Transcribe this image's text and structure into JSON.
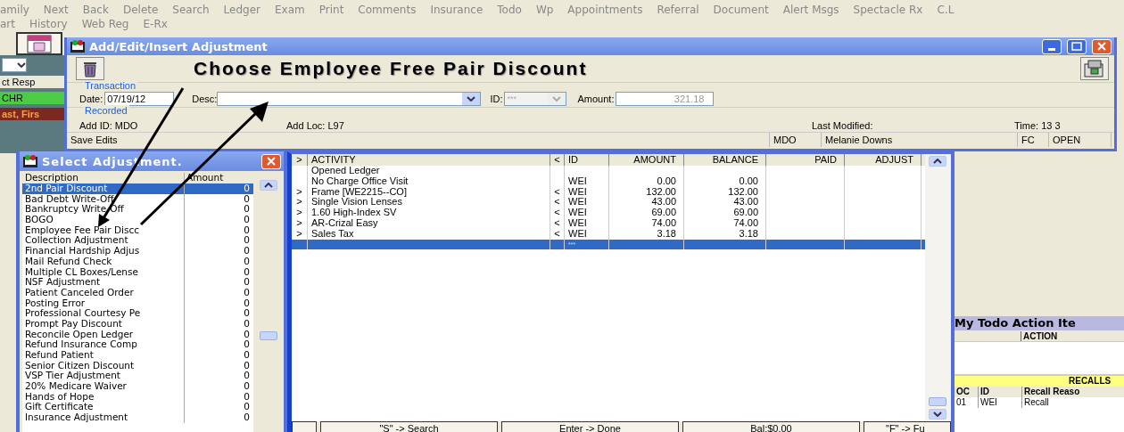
{
  "menu_bar": {
    "row_1": [
      "amily",
      "Next",
      "Back",
      "Delete",
      "Search",
      "Ledger",
      "Exam",
      "Print",
      "Comments",
      "Insurance",
      "Todo",
      "Wp",
      "Appointments",
      "Referral",
      "Document",
      "Alert Msgs",
      "Spectacle Rx",
      "C.L"
    ],
    "row_2": [
      "art",
      "History",
      "Web Reg",
      "E-Rx"
    ]
  },
  "side_labels": [
    {
      "text": "ct Resp",
      "kind": "plain"
    },
    {
      "text": "CHR",
      "kind": "green"
    },
    {
      "text": "ast, Firs",
      "kind": "orange"
    }
  ],
  "adjustment_window": {
    "title": "Add/Edit/Insert Adjustment",
    "heading": "Choose Employee Free Pair Discount",
    "transaction": {
      "legend": "Transaction",
      "date_label": "Date:",
      "date": "07/19/12",
      "desc_label": "Desc:",
      "id_label": "ID:",
      "id_value": "***",
      "amount_label": "Amount:",
      "amount": "321.18"
    },
    "recorded": {
      "legend": "Recorded",
      "add_id": "Add ID: MDO",
      "add_loc": "Add Loc: L97",
      "last_modified": "Last Modified:",
      "time": "Time: 13   3"
    },
    "status_bar": [
      "Save Edits",
      "MDO",
      "Melanie Downs",
      "FC",
      "OPEN"
    ]
  },
  "select_window": {
    "title": "Select Adjustment.",
    "columns": [
      "Description",
      "Amount"
    ],
    "rows": [
      {
        "description": "2nd Pair Discount",
        "amount": "0",
        "selected": true
      },
      {
        "description": "Bad Debt Write-Off",
        "amount": "0",
        "selected": false
      },
      {
        "description": "Bankruptcy Write-Off",
        "amount": "0",
        "selected": false
      },
      {
        "description": "BOGO",
        "amount": "0",
        "selected": false
      },
      {
        "description": "Employee Fee Pair Discc",
        "amount": "0",
        "selected": false
      },
      {
        "description": "Collection Adjustment",
        "amount": "0",
        "selected": false
      },
      {
        "description": "Financial Hardship Adjus",
        "amount": "0",
        "selected": false
      },
      {
        "description": "Mail Refund Check",
        "amount": "0",
        "selected": false
      },
      {
        "description": "Multiple CL Boxes/Lense",
        "amount": "0",
        "selected": false
      },
      {
        "description": "NSF Adjustment",
        "amount": "0",
        "selected": false
      },
      {
        "description": "Patient Canceled Order",
        "amount": "0",
        "selected": false
      },
      {
        "description": "Posting Error",
        "amount": "0",
        "selected": false
      },
      {
        "description": "Professional Courtesy Pe",
        "amount": "0",
        "selected": false
      },
      {
        "description": "Prompt Pay Discount",
        "amount": "0",
        "selected": false
      },
      {
        "description": "Reconcile Open Ledger",
        "amount": "0",
        "selected": false
      },
      {
        "description": "Refund Insurance Comp",
        "amount": "0",
        "selected": false
      },
      {
        "description": "Refund Patient",
        "amount": "0",
        "selected": false
      },
      {
        "description": "Senior Citizen Discount",
        "amount": "0",
        "selected": false
      },
      {
        "description": "VSP Tier Adjustment",
        "amount": "0",
        "selected": false
      },
      {
        "description": "20% Medicare Waiver",
        "amount": "0",
        "selected": false
      },
      {
        "description": "Hands of Hope",
        "amount": "0",
        "selected": false
      },
      {
        "description": "Gift Certificate",
        "amount": "0",
        "selected": false
      },
      {
        "description": "Insurance Adjustment",
        "amount": "0",
        "selected": false
      }
    ]
  },
  "ledger": {
    "columns": [
      ">",
      "ACTIVITY",
      "<",
      "ID",
      "AMOUNT",
      "BALANCE",
      "PAID",
      "ADJUST"
    ],
    "rows": [
      {
        "expand": "",
        "activity": "Opened Ledger",
        "back": "",
        "id": "",
        "amount": "",
        "balance": "",
        "selected": false
      },
      {
        "expand": "",
        "activity": "No Charge Office Visit",
        "back": "",
        "id": "WEI",
        "amount": "0.00",
        "balance": "0.00",
        "selected": false
      },
      {
        "expand": ">",
        "activity": "Frame [WE2215--CO]",
        "back": "<",
        "id": "WEI",
        "amount": "132.00",
        "balance": "132.00",
        "selected": false
      },
      {
        "expand": ">",
        "activity": "Single Vision Lenses",
        "back": "<",
        "id": "WEI",
        "amount": "43.00",
        "balance": "43.00",
        "selected": false
      },
      {
        "expand": ">",
        "activity": "1.60 High-Index SV",
        "back": "<",
        "id": "WEI",
        "amount": "69.00",
        "balance": "69.00",
        "selected": false
      },
      {
        "expand": ">",
        "activity": "AR-Crizal Easy",
        "back": "<",
        "id": "WEI",
        "amount": "74.00",
        "balance": "74.00",
        "selected": false
      },
      {
        "expand": ">",
        "activity": "Sales Tax",
        "back": "<",
        "id": "WEI",
        "amount": "3.18",
        "balance": "3.18",
        "selected": false
      },
      {
        "expand": "",
        "activity": "",
        "back": "",
        "id": "***",
        "amount": "",
        "balance": "",
        "selected": true
      }
    ],
    "buttons": [
      "\"S\" -> Search",
      "Enter -> Done",
      "Bal:$0.00",
      "\"F\" -> Fu"
    ]
  },
  "todo_panel": {
    "title": "My Todo Action Ite",
    "action_column": "ACTION",
    "recalls_title": "RECALLS",
    "columns": [
      "OC",
      "ID",
      "Recall Reaso"
    ],
    "rows": [
      [
        "01",
        "WEI",
        "Recall"
      ]
    ]
  }
}
